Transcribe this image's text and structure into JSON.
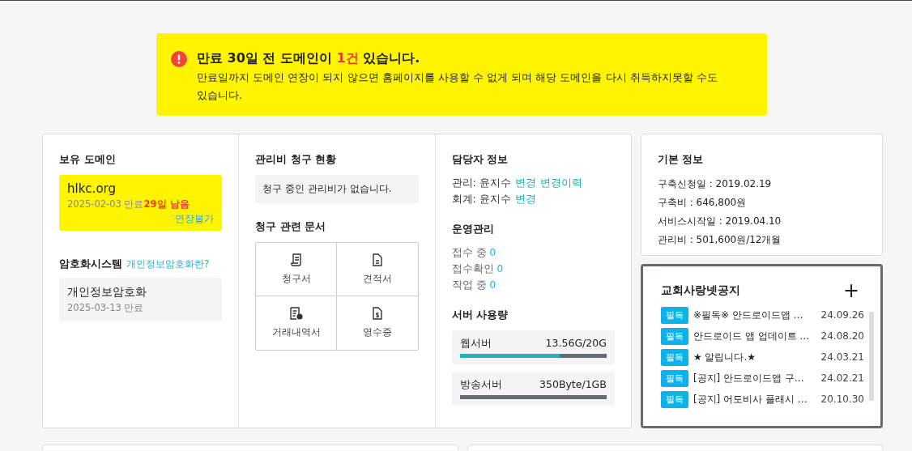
{
  "alert": {
    "title_before": "만료 30일 전 도메인이 ",
    "title_highlight": "1건",
    "title_after": " 있습니다.",
    "message": "만료일까지 도메인 연장이 되지 않으면 홈페이지를 사용할 수 없게 되며 해당 도메인을 다시 취득하지못할 수도 있습니다."
  },
  "domains": {
    "title": "보유 도메인",
    "items": [
      {
        "name": "hlkc.org",
        "expiry": "2025-02-03 만료",
        "remaining": "29일 남음",
        "action": "연장불가"
      }
    ]
  },
  "encryption": {
    "title": "암호화시스템",
    "link": "개인정보암호화란?",
    "items": [
      {
        "name": "개인정보암호화",
        "expiry": "2025-03-13 만료"
      }
    ]
  },
  "billing": {
    "title": "관리비 청구 현황",
    "empty": "청구 중인 관리비가 없습니다."
  },
  "documents": {
    "title": "청구 관련 문서",
    "items": [
      {
        "kind": "invoice",
        "label": "청구서"
      },
      {
        "kind": "quote",
        "label": "견적서"
      },
      {
        "kind": "statement",
        "label": "거래내역서"
      },
      {
        "kind": "receipt",
        "label": "영수증"
      }
    ]
  },
  "contacts": {
    "title": "담당자 정보",
    "rows": [
      {
        "label": "관리:",
        "name": "윤지수",
        "links": [
          "변경",
          "변경이력"
        ]
      },
      {
        "label": "회계:",
        "name": "윤지수",
        "links": [
          "변경"
        ]
      }
    ]
  },
  "operations": {
    "title": "운영관리",
    "rows": [
      {
        "label": "접수 중",
        "count": "0"
      },
      {
        "label": "접수확인",
        "count": "0"
      },
      {
        "label": "작업 중",
        "count": "0"
      }
    ]
  },
  "servers": {
    "title": "서버 사용량",
    "items": [
      {
        "name": "웹서버",
        "usage": "13.56G/20G",
        "level": 0.678
      },
      {
        "name": "방송서버",
        "usage": "350Byte/1GB",
        "level": 0
      }
    ]
  },
  "basic_info": {
    "title": "기본 정보",
    "rows": [
      "구축신청일 : 2019.02.19",
      "구축비 :  646,800원",
      "서비스시작일 : 2019.04.10",
      "관리비 : 501,600원/12개월"
    ]
  },
  "notices": {
    "title": "교회사랑넷공지",
    "add": "+",
    "items": [
      {
        "badge": "필독",
        "title": "※필독※ 안드로이드앱 …",
        "date": "24.09.26"
      },
      {
        "badge": "필독",
        "title": "안드로이드 앱 업데이트 …",
        "date": "24.08.20"
      },
      {
        "badge": "필독",
        "title": "★ 알립니다.★",
        "date": "24.03.21"
      },
      {
        "badge": "필독",
        "title": "[공지] 안드로이드앱 구…",
        "date": "24.02.21"
      },
      {
        "badge": "필독",
        "title": "[공지] 어도비사 플래시 …",
        "date": "20.10.30"
      }
    ]
  }
}
